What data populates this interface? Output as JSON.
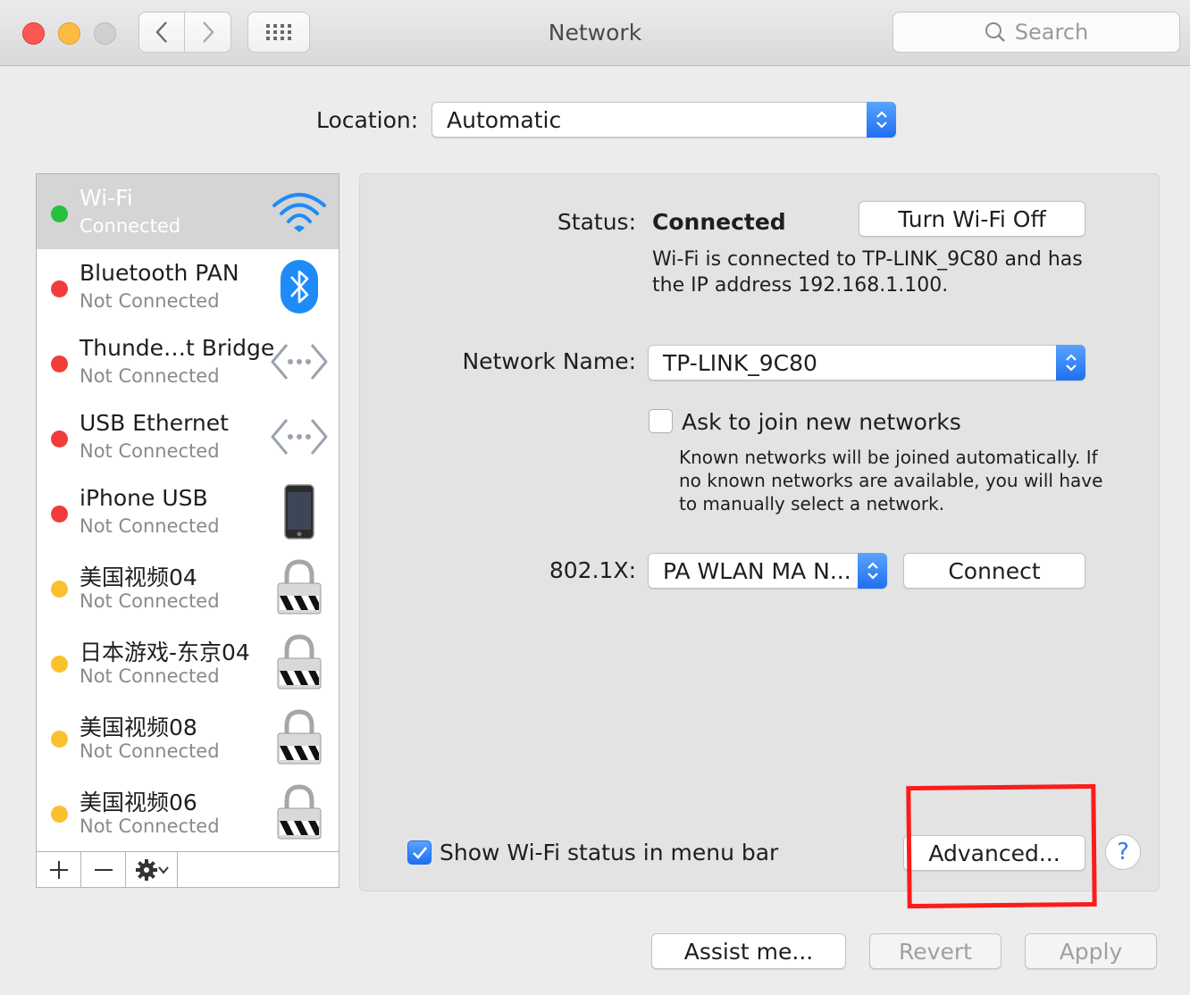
{
  "window": {
    "title": "Network"
  },
  "toolbar": {
    "search_placeholder": "Search"
  },
  "location": {
    "label": "Location:",
    "value": "Automatic"
  },
  "services": [
    {
      "name": "Wi-Fi",
      "status": "Connected",
      "dot_color": "#27c13c",
      "icon": "wifi-icon"
    },
    {
      "name": "Bluetooth PAN",
      "status": "Not Connected",
      "dot_color": "#f23c3c",
      "icon": "bluetooth-icon"
    },
    {
      "name": "Thunde…t Bridge",
      "status": "Not Connected",
      "dot_color": "#f23c3c",
      "icon": "ethernet-arrows-icon"
    },
    {
      "name": "USB Ethernet",
      "status": "Not Connected",
      "dot_color": "#f23c3c",
      "icon": "ethernet-arrows-icon"
    },
    {
      "name": "iPhone USB",
      "status": "Not Connected",
      "dot_color": "#f23c3c",
      "icon": "iphone-icon"
    },
    {
      "name": "美国视频04",
      "status": "Not Connected",
      "dot_color": "#fbc02d",
      "icon": "vpn-lock-icon"
    },
    {
      "name": "日本游戏-东京04",
      "status": "Not Connected",
      "dot_color": "#fbc02d",
      "icon": "vpn-lock-icon"
    },
    {
      "name": "美国视频08",
      "status": "Not Connected",
      "dot_color": "#fbc02d",
      "icon": "vpn-lock-icon"
    },
    {
      "name": "美国视频06",
      "status": "Not Connected",
      "dot_color": "#fbc02d",
      "icon": "vpn-lock-icon"
    }
  ],
  "detail": {
    "status_label": "Status:",
    "status_value": "Connected",
    "turn_off_button": "Turn Wi-Fi Off",
    "status_line1": "Wi-Fi is connected to TP-LINK_9C80 and has",
    "status_line2": "the IP address 192.168.1.100.",
    "network_name_label": "Network Name:",
    "network_name_value": "TP-LINK_9C80",
    "ask_join_label": "Ask to join new networks",
    "ask_join_checked": false,
    "ask_join_help1": "Known networks will be joined automatically. If",
    "ask_join_help2": "no known networks are available, you will have",
    "ask_join_help3": "to manually select a network.",
    "dot1x_label": "802.1X:",
    "dot1x_value": "PA WLAN MA N...",
    "connect_button": "Connect",
    "show_status_label": "Show Wi-Fi status in menu bar",
    "show_status_checked": true,
    "advanced_button": "Advanced...",
    "help_button": "?"
  },
  "footer": {
    "assist_button": "Assist me...",
    "revert_button": "Revert",
    "apply_button": "Apply"
  },
  "colors": {
    "accent": "#1e6ff0",
    "highlight_box": "#fa1c1c"
  }
}
